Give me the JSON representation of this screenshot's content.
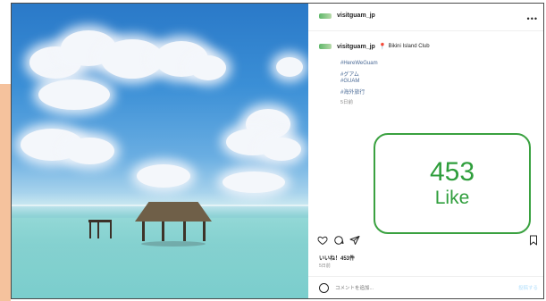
{
  "post": {
    "account": "visitguam_jp",
    "location": "Bikini Island Club",
    "more_label": "•••",
    "caption": {
      "hashtags": [
        "#HereWeGuam",
        "#グアム",
        "#GUAM",
        "#海外旅行"
      ],
      "time": "5日前"
    },
    "likes_text": "いいね！453件",
    "post_time": "5日前",
    "comment_placeholder": "コメントを追加...",
    "post_button": "投稿する"
  },
  "callout": {
    "count": "453",
    "label": "Like"
  },
  "colors": {
    "accent_green": "#2f9e3c",
    "left_accent": "#f5c29d",
    "hashtag": "#4a6a96"
  },
  "icons": [
    "heart-icon",
    "comment-icon",
    "share-icon",
    "bookmark-icon",
    "smile-icon",
    "location-pin-icon",
    "more-icon"
  ]
}
